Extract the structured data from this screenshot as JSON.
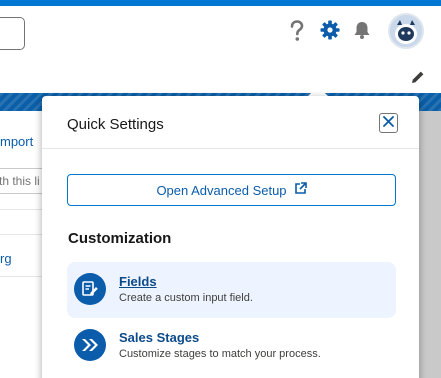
{
  "header": {
    "help_icon": "question-mark-icon",
    "setup_icon": "gear-icon",
    "notifications_icon": "bell-icon",
    "avatar_icon": "astro-avatar"
  },
  "background": {
    "import_link": "mport",
    "search_placeholder": "th this li",
    "org_link": "rg"
  },
  "quick_settings": {
    "title": "Quick Settings",
    "close_icon": "close-icon",
    "advanced_setup_label": "Open Advanced Setup",
    "advanced_setup_icon": "external-link-icon",
    "section_heading": "Customization",
    "items": [
      {
        "title": "Fields",
        "description": "Create a custom input field.",
        "icon": "edit-field-icon",
        "selected": true
      },
      {
        "title": "Sales Stages",
        "description": "Customize stages to match your process.",
        "icon": "double-chevron-right-icon",
        "selected": false
      }
    ]
  },
  "colors": {
    "brand_blue": "#0176d3",
    "link_blue": "#0b5cab",
    "selected_row_bg": "#eef4ff"
  }
}
